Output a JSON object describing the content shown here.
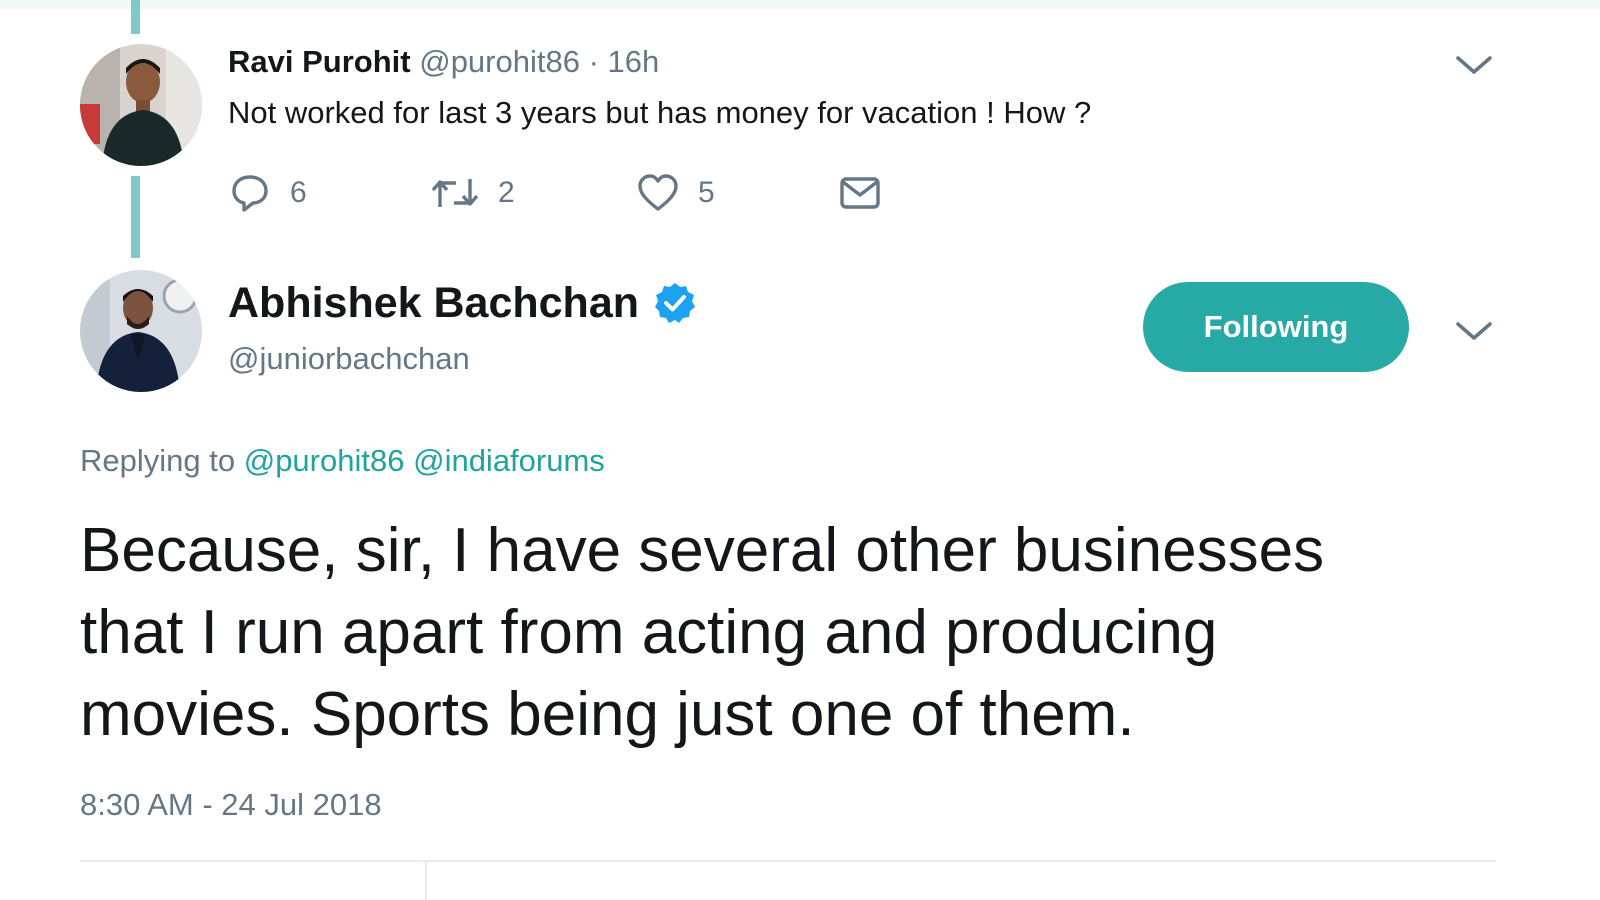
{
  "colors": {
    "accent": "#27aaa5",
    "link": "#20a39e",
    "thread_line": "#7fcac6",
    "muted_text": "#657786",
    "verified": "#1da1f2"
  },
  "parent_tweet": {
    "author_name": "Ravi Purohit",
    "author_handle": "@purohit86",
    "separator": "·",
    "time": "16h",
    "text": "Not worked for last 3 years but has money for vacation ! How ?",
    "actions": {
      "reply_icon": "reply-icon",
      "reply_count": "6",
      "retweet_icon": "retweet-icon",
      "retweet_count": "2",
      "like_icon": "heart-icon",
      "like_count": "5",
      "dm_icon": "envelope-icon"
    },
    "menu_icon": "chevron-down-icon"
  },
  "reply_tweet": {
    "author_name": "Abhishek Bachchan",
    "verified_icon": "verified-badge-icon",
    "author_handle": "@juniorbachchan",
    "follow_button_label": "Following",
    "menu_icon": "chevron-down-icon",
    "replying_to_label": "Replying to",
    "replying_to_mentions": [
      "@purohit86",
      "@indiaforums"
    ],
    "text_lines": [
      "Because, sir, I have several other businesses",
      "that I run apart from acting and producing",
      "movies. Sports being just one of them."
    ],
    "timestamp": "8:30 AM - 24 Jul 2018"
  }
}
